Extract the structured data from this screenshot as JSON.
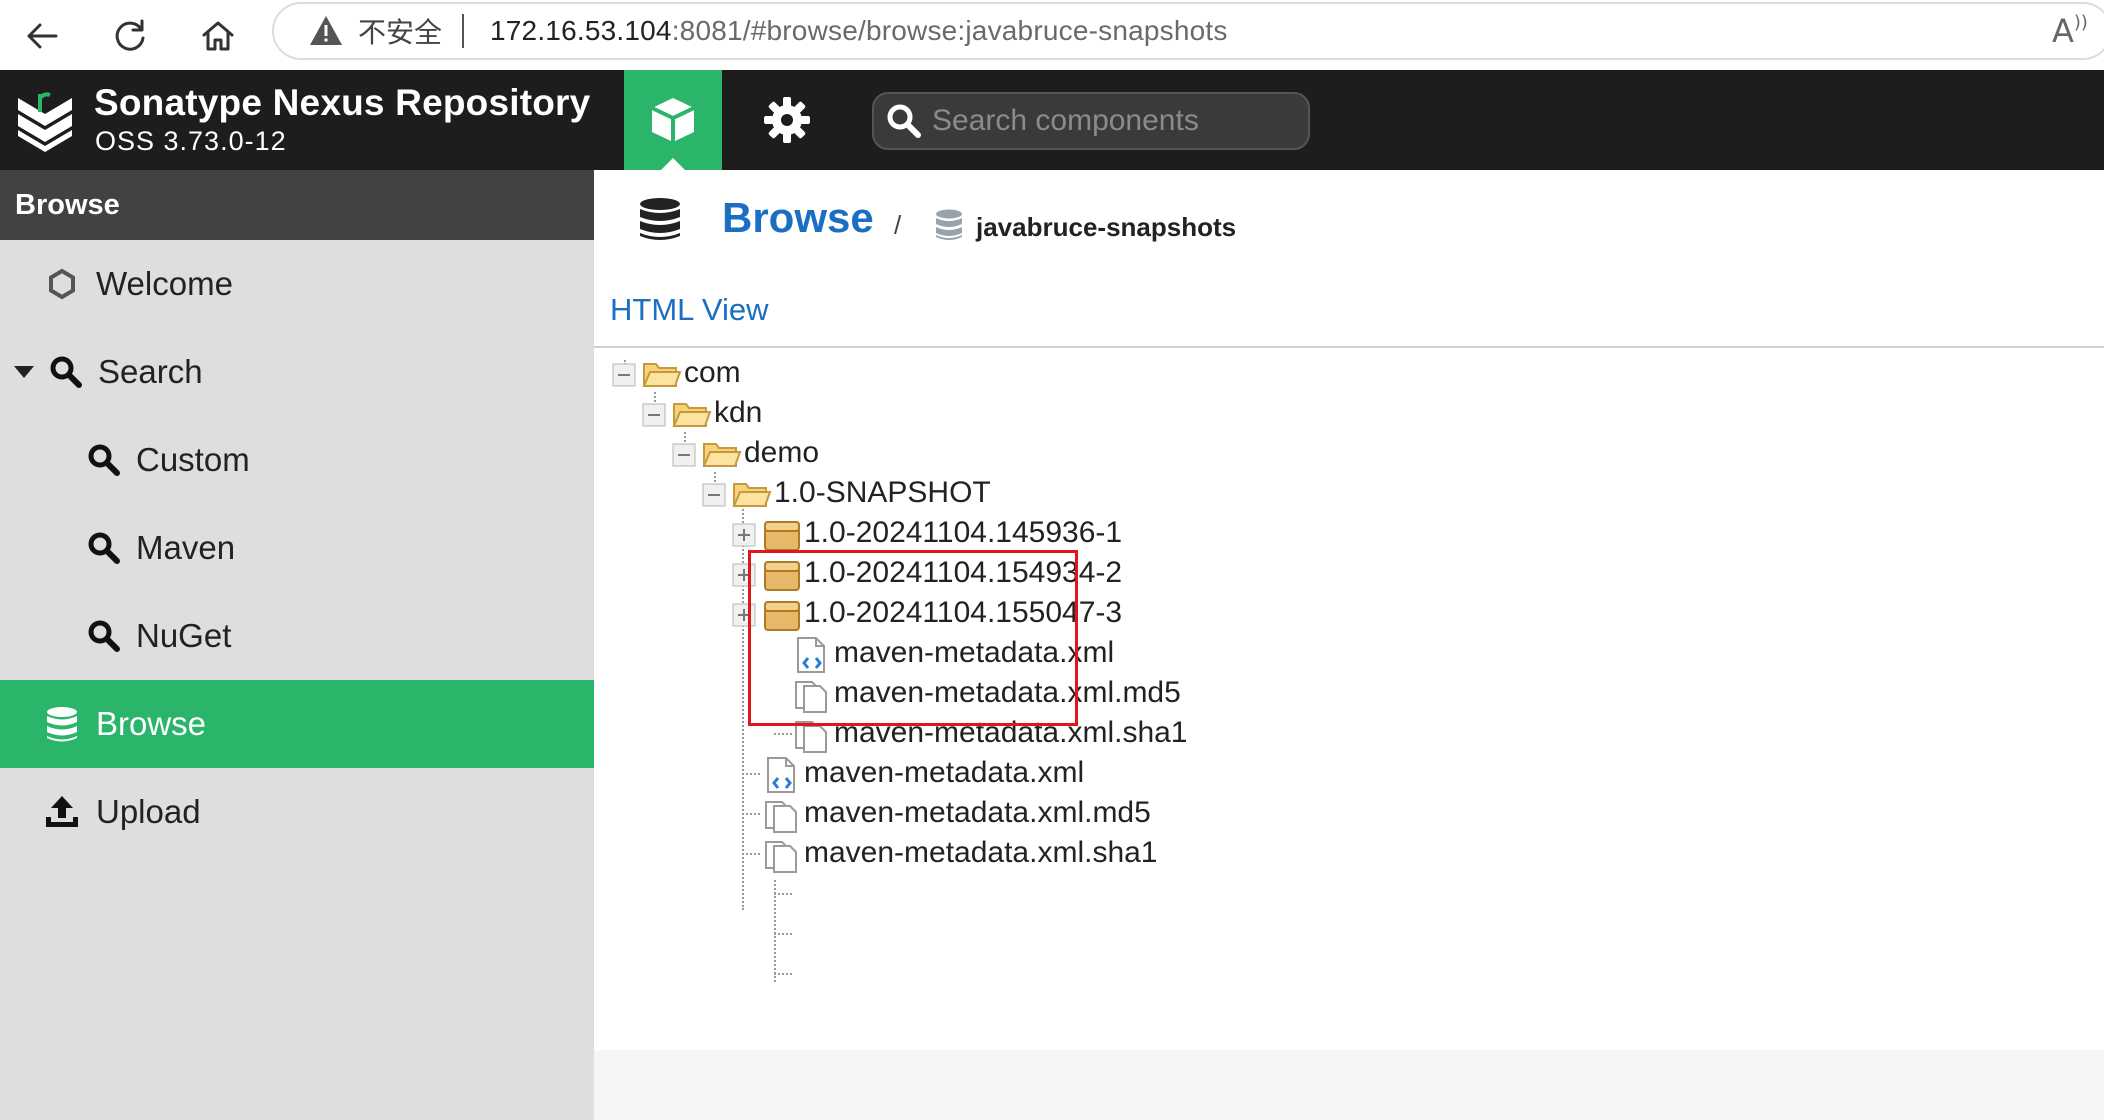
{
  "browser": {
    "security_label": "不安全",
    "url_host": "172.16.53.104",
    "url_rest": ":8081/#browse/browse:javabruce-snapshots"
  },
  "header": {
    "title": "Sonatype Nexus Repository",
    "version": "OSS 3.73.0-12",
    "search_placeholder": "Search components",
    "colors": {
      "bar": "#1d1d1d",
      "accent": "#2ab56a"
    }
  },
  "sidebar": {
    "heading": "Browse",
    "items": [
      {
        "label": "Welcome",
        "icon": "hexagon-icon"
      },
      {
        "label": "Search",
        "icon": "search-icon"
      },
      {
        "label": "Custom",
        "icon": "search-icon"
      },
      {
        "label": "Maven",
        "icon": "search-icon"
      },
      {
        "label": "NuGet",
        "icon": "search-icon"
      },
      {
        "label": "Browse",
        "icon": "database-icon",
        "active": true
      },
      {
        "label": "Upload",
        "icon": "upload-icon"
      }
    ]
  },
  "main": {
    "breadcrumb_root": "Browse",
    "breadcrumb_sep": "/",
    "repository": "javabruce-snapshots",
    "html_view_link": "HTML View",
    "tree": [
      {
        "label": "com",
        "type": "folder"
      },
      {
        "label": "kdn",
        "type": "folder"
      },
      {
        "label": "demo",
        "type": "folder"
      },
      {
        "label": "1.0-SNAPSHOT",
        "type": "folder"
      },
      {
        "label": "1.0-20241104.145936-1",
        "type": "component"
      },
      {
        "label": "1.0-20241104.154934-2",
        "type": "component"
      },
      {
        "label": "1.0-20241104.155047-3",
        "type": "component"
      },
      {
        "label": "maven-metadata.xml",
        "type": "xml"
      },
      {
        "label": "maven-metadata.xml.md5",
        "type": "file"
      },
      {
        "label": "maven-metadata.xml.sha1",
        "type": "file"
      },
      {
        "label": "maven-metadata.xml",
        "type": "xml"
      },
      {
        "label": "maven-metadata.xml.md5",
        "type": "file"
      },
      {
        "label": "maven-metadata.xml.sha1",
        "type": "file"
      }
    ]
  }
}
